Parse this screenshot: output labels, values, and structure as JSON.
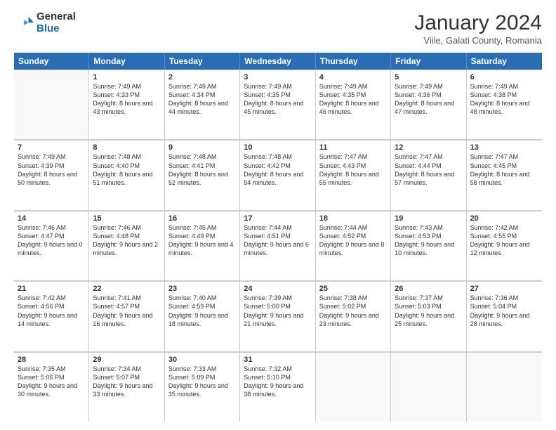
{
  "logo": {
    "general": "General",
    "blue": "Blue"
  },
  "header": {
    "month": "January 2024",
    "location": "Viile, Galati County, Romania"
  },
  "weekdays": [
    "Sunday",
    "Monday",
    "Tuesday",
    "Wednesday",
    "Thursday",
    "Friday",
    "Saturday"
  ],
  "rows": [
    [
      {
        "day": "",
        "empty": true
      },
      {
        "day": "1",
        "sunrise": "7:49 AM",
        "sunset": "4:33 PM",
        "daylight": "8 hours and 43 minutes."
      },
      {
        "day": "2",
        "sunrise": "7:49 AM",
        "sunset": "4:34 PM",
        "daylight": "8 hours and 44 minutes."
      },
      {
        "day": "3",
        "sunrise": "7:49 AM",
        "sunset": "4:35 PM",
        "daylight": "8 hours and 45 minutes."
      },
      {
        "day": "4",
        "sunrise": "7:49 AM",
        "sunset": "4:35 PM",
        "daylight": "8 hours and 46 minutes."
      },
      {
        "day": "5",
        "sunrise": "7:49 AM",
        "sunset": "4:36 PM",
        "daylight": "8 hours and 47 minutes."
      },
      {
        "day": "6",
        "sunrise": "7:49 AM",
        "sunset": "4:38 PM",
        "daylight": "8 hours and 48 minutes."
      }
    ],
    [
      {
        "day": "7",
        "sunrise": "7:49 AM",
        "sunset": "4:39 PM",
        "daylight": "8 hours and 50 minutes."
      },
      {
        "day": "8",
        "sunrise": "7:48 AM",
        "sunset": "4:40 PM",
        "daylight": "8 hours and 51 minutes."
      },
      {
        "day": "9",
        "sunrise": "7:48 AM",
        "sunset": "4:41 PM",
        "daylight": "8 hours and 52 minutes."
      },
      {
        "day": "10",
        "sunrise": "7:48 AM",
        "sunset": "4:42 PM",
        "daylight": "8 hours and 54 minutes."
      },
      {
        "day": "11",
        "sunrise": "7:47 AM",
        "sunset": "4:43 PM",
        "daylight": "8 hours and 55 minutes."
      },
      {
        "day": "12",
        "sunrise": "7:47 AM",
        "sunset": "4:44 PM",
        "daylight": "8 hours and 57 minutes."
      },
      {
        "day": "13",
        "sunrise": "7:47 AM",
        "sunset": "4:45 PM",
        "daylight": "8 hours and 58 minutes."
      }
    ],
    [
      {
        "day": "14",
        "sunrise": "7:46 AM",
        "sunset": "4:47 PM",
        "daylight": "9 hours and 0 minutes."
      },
      {
        "day": "15",
        "sunrise": "7:46 AM",
        "sunset": "4:48 PM",
        "daylight": "9 hours and 2 minutes."
      },
      {
        "day": "16",
        "sunrise": "7:45 AM",
        "sunset": "4:49 PM",
        "daylight": "9 hours and 4 minutes."
      },
      {
        "day": "17",
        "sunrise": "7:44 AM",
        "sunset": "4:51 PM",
        "daylight": "9 hours and 6 minutes."
      },
      {
        "day": "18",
        "sunrise": "7:44 AM",
        "sunset": "4:52 PM",
        "daylight": "9 hours and 8 minutes."
      },
      {
        "day": "19",
        "sunrise": "7:43 AM",
        "sunset": "4:53 PM",
        "daylight": "9 hours and 10 minutes."
      },
      {
        "day": "20",
        "sunrise": "7:42 AM",
        "sunset": "4:55 PM",
        "daylight": "9 hours and 12 minutes."
      }
    ],
    [
      {
        "day": "21",
        "sunrise": "7:42 AM",
        "sunset": "4:56 PM",
        "daylight": "9 hours and 14 minutes."
      },
      {
        "day": "22",
        "sunrise": "7:41 AM",
        "sunset": "4:57 PM",
        "daylight": "9 hours and 16 minutes."
      },
      {
        "day": "23",
        "sunrise": "7:40 AM",
        "sunset": "4:59 PM",
        "daylight": "9 hours and 18 minutes."
      },
      {
        "day": "24",
        "sunrise": "7:39 AM",
        "sunset": "5:00 PM",
        "daylight": "9 hours and 21 minutes."
      },
      {
        "day": "25",
        "sunrise": "7:38 AM",
        "sunset": "5:02 PM",
        "daylight": "9 hours and 23 minutes."
      },
      {
        "day": "26",
        "sunrise": "7:37 AM",
        "sunset": "5:03 PM",
        "daylight": "9 hours and 25 minutes."
      },
      {
        "day": "27",
        "sunrise": "7:36 AM",
        "sunset": "5:04 PM",
        "daylight": "9 hours and 28 minutes."
      }
    ],
    [
      {
        "day": "28",
        "sunrise": "7:35 AM",
        "sunset": "5:06 PM",
        "daylight": "9 hours and 30 minutes."
      },
      {
        "day": "29",
        "sunrise": "7:34 AM",
        "sunset": "5:07 PM",
        "daylight": "9 hours and 33 minutes."
      },
      {
        "day": "30",
        "sunrise": "7:33 AM",
        "sunset": "5:09 PM",
        "daylight": "9 hours and 35 minutes."
      },
      {
        "day": "31",
        "sunrise": "7:32 AM",
        "sunset": "5:10 PM",
        "daylight": "9 hours and 38 minutes."
      },
      {
        "day": "",
        "empty": true
      },
      {
        "day": "",
        "empty": true
      },
      {
        "day": "",
        "empty": true
      }
    ]
  ]
}
